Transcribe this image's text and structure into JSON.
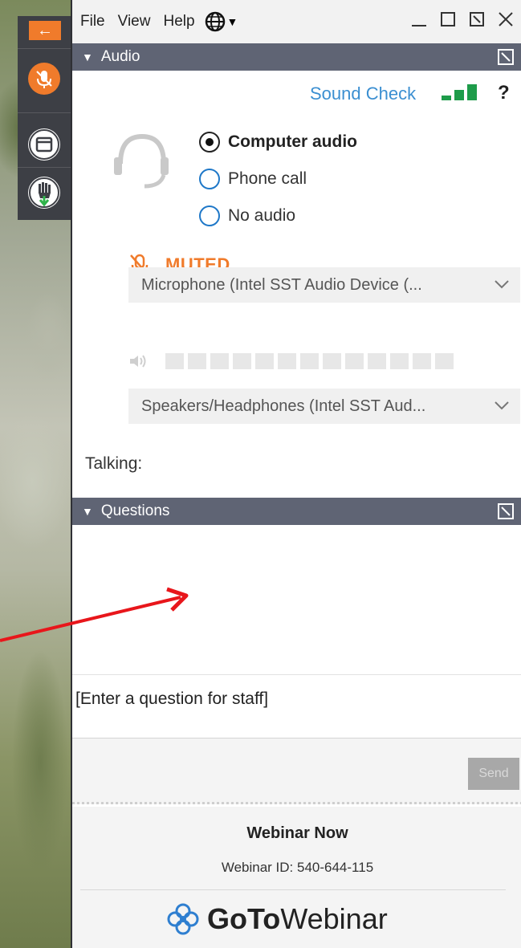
{
  "menu": {
    "file": "File",
    "view": "View",
    "help": "Help"
  },
  "audio": {
    "section_title": "Audio",
    "sound_check": "Sound Check",
    "help": "?",
    "options": [
      {
        "label": "Computer audio",
        "selected": true
      },
      {
        "label": "Phone call",
        "selected": false
      },
      {
        "label": "No audio",
        "selected": false
      }
    ],
    "muted_label": "MUTED",
    "microphone": "Microphone (Intel SST Audio Device (...",
    "speakers": "Speakers/Headphones (Intel SST Aud...",
    "talking_label": "Talking:",
    "speaker_level": 0
  },
  "questions": {
    "section_title": "Questions",
    "input_placeholder": "[Enter a question for staff]",
    "send_label": "Send"
  },
  "footer": {
    "title": "Webinar Now",
    "webinar_id": "Webinar ID: 540-644-115",
    "brand_go": "GoTo",
    "brand_rest": "Webinar"
  },
  "colors": {
    "accent_orange": "#f07b2b",
    "section_bar": "#5f6474",
    "link_blue": "#3b8fd1",
    "signal_green": "#1e9c4a",
    "annotation_red": "#e8161b"
  },
  "icons": {
    "collapse": "arrow-left-icon",
    "mic": "muted-mic-icon",
    "screen": "screen-icon",
    "hand": "raise-hand-icon",
    "globe": "globe-icon",
    "headset": "headset-icon",
    "speaker": "speaker-icon",
    "popout": "popout-icon"
  }
}
